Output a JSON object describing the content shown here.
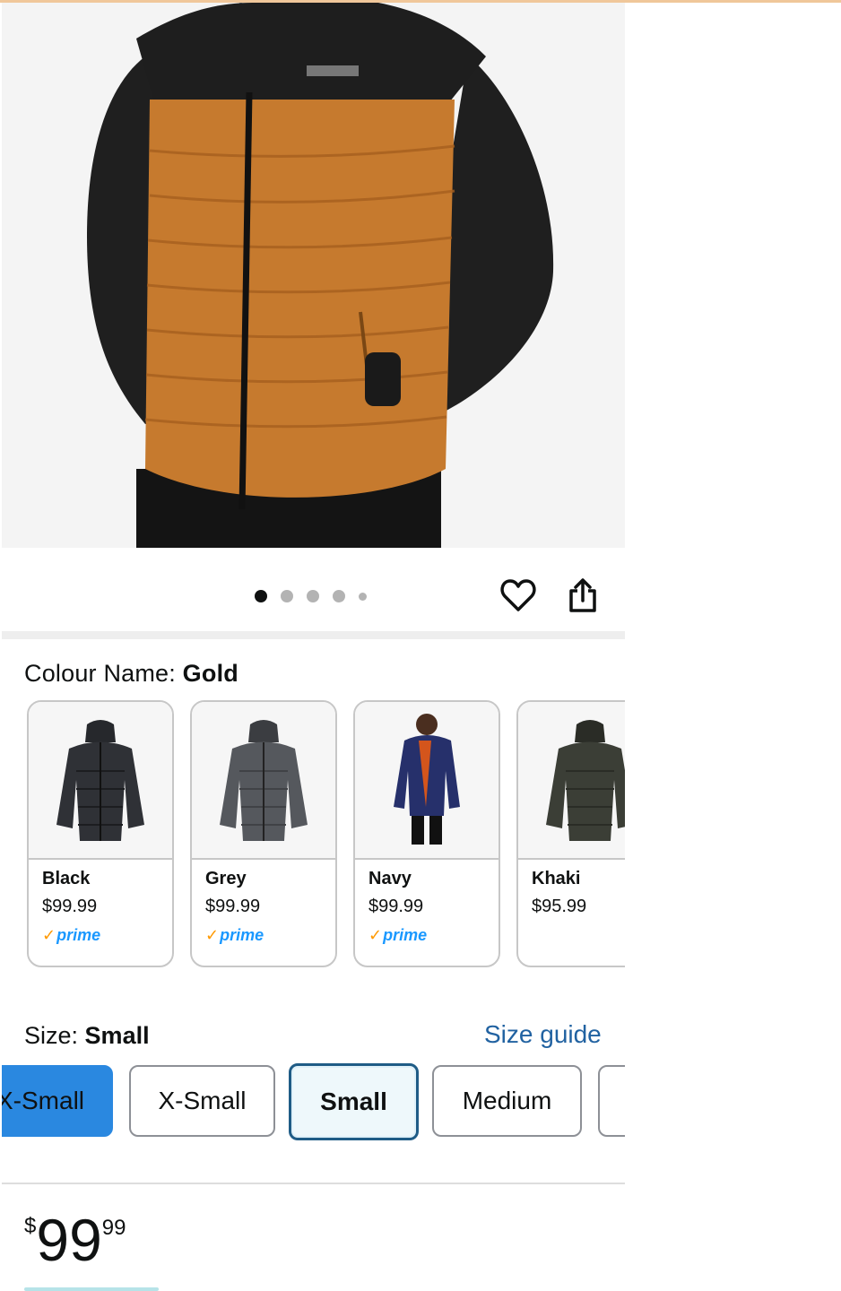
{
  "gallery": {
    "dot_count": 5,
    "active_dot": 0,
    "hero_colors": {
      "body": "#c67a2e",
      "shoulders": "#1e1e1e",
      "background": "#f4f4f4"
    }
  },
  "colour": {
    "label": "Colour Name:",
    "selected": "Gold",
    "options": [
      {
        "name": "Black",
        "price": "$99.99",
        "prime": true,
        "jacket_color": "#2f3136"
      },
      {
        "name": "Grey",
        "price": "$99.99",
        "prime": true,
        "jacket_color": "#55585d"
      },
      {
        "name": "Navy",
        "price": "$99.99",
        "prime": true,
        "jacket_color": "#26306b"
      },
      {
        "name": "Khaki",
        "price": "$95.99",
        "prime": false,
        "jacket_color": "#3b3e36"
      }
    ],
    "prime_text": "prime"
  },
  "size": {
    "label": "Size:",
    "selected": "Small",
    "guide": "Size guide",
    "options": [
      "X-Small",
      "X-Small",
      "Small",
      "Medium",
      ""
    ]
  },
  "price": {
    "symbol": "$",
    "whole": "99",
    "fraction": "99"
  },
  "colors": {
    "link": "#2162a1",
    "prime_blue": "#1a98ff",
    "prime_check": "#ff9900",
    "selected_border": "#1f5c86"
  }
}
